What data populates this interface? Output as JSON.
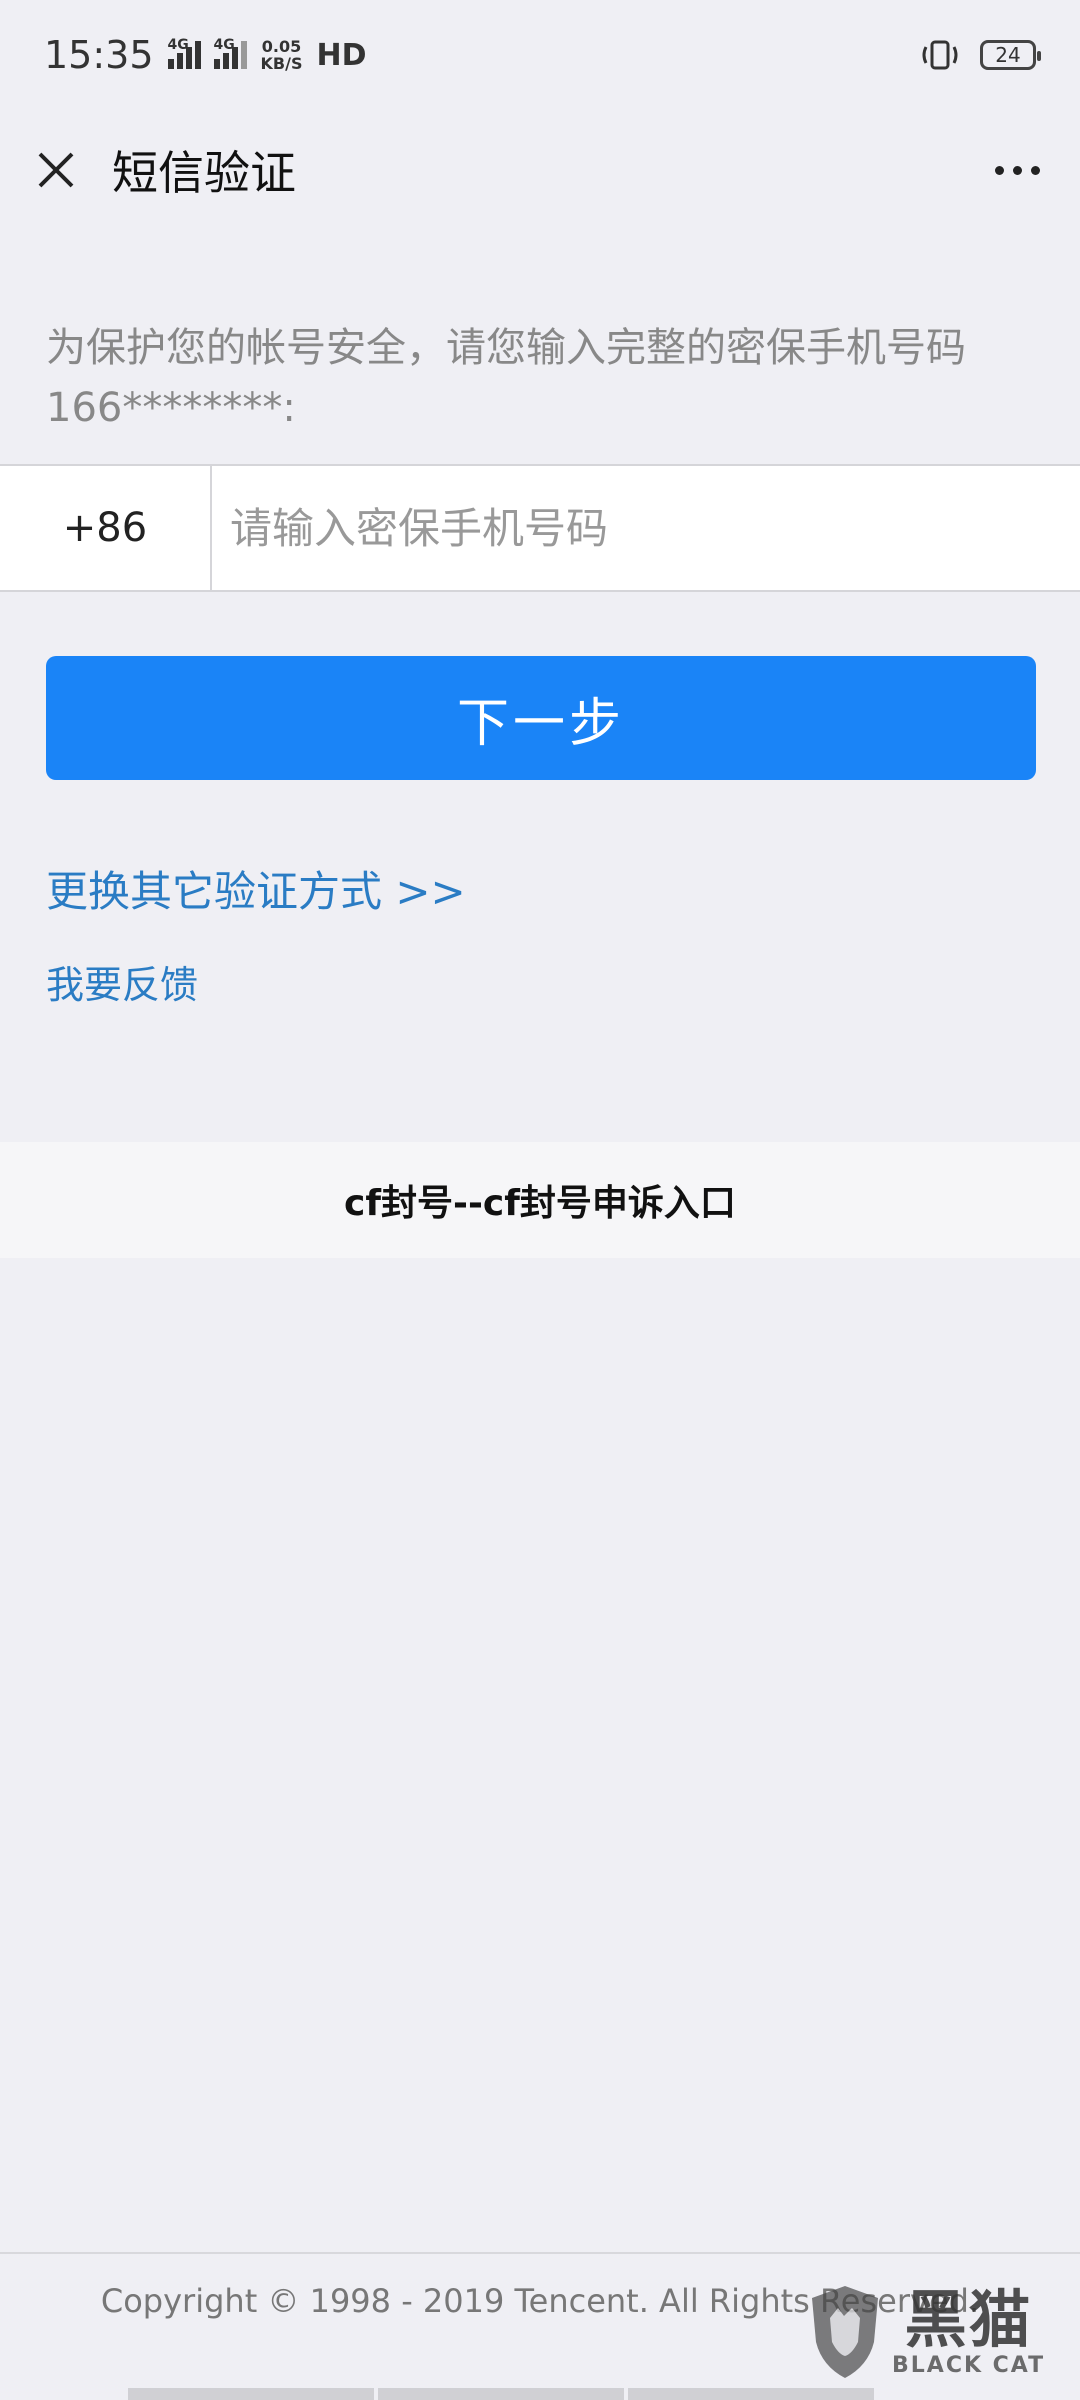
{
  "status_bar": {
    "time": "15:35",
    "network_label": "4G",
    "speed_value": "0.05",
    "speed_unit": "KB/S",
    "hd_label": "HD",
    "battery": "24"
  },
  "nav": {
    "title": "短信验证",
    "close_icon": "close-icon",
    "more_icon": "more-icon"
  },
  "instruction": "为保护您的帐号安全，请您输入完整的密保手机号码166********:",
  "phone": {
    "country_code": "+86",
    "placeholder": "请输入密保手机号码",
    "value": ""
  },
  "next_button_label": "下一步",
  "links": {
    "switch_method": "更换其它验证方式 >>",
    "feedback": "我要反馈"
  },
  "banner": "cf封号--cf封号申诉入口",
  "copyright": "Copyright © 1998 - 2019 Tencent. All Rights Reserved.",
  "watermark": {
    "cn": "黑猫",
    "en": "BLACK CAT"
  },
  "colors": {
    "primary_button": "#1a84f7",
    "link": "#2a7cc4",
    "background": "#efeff4"
  }
}
